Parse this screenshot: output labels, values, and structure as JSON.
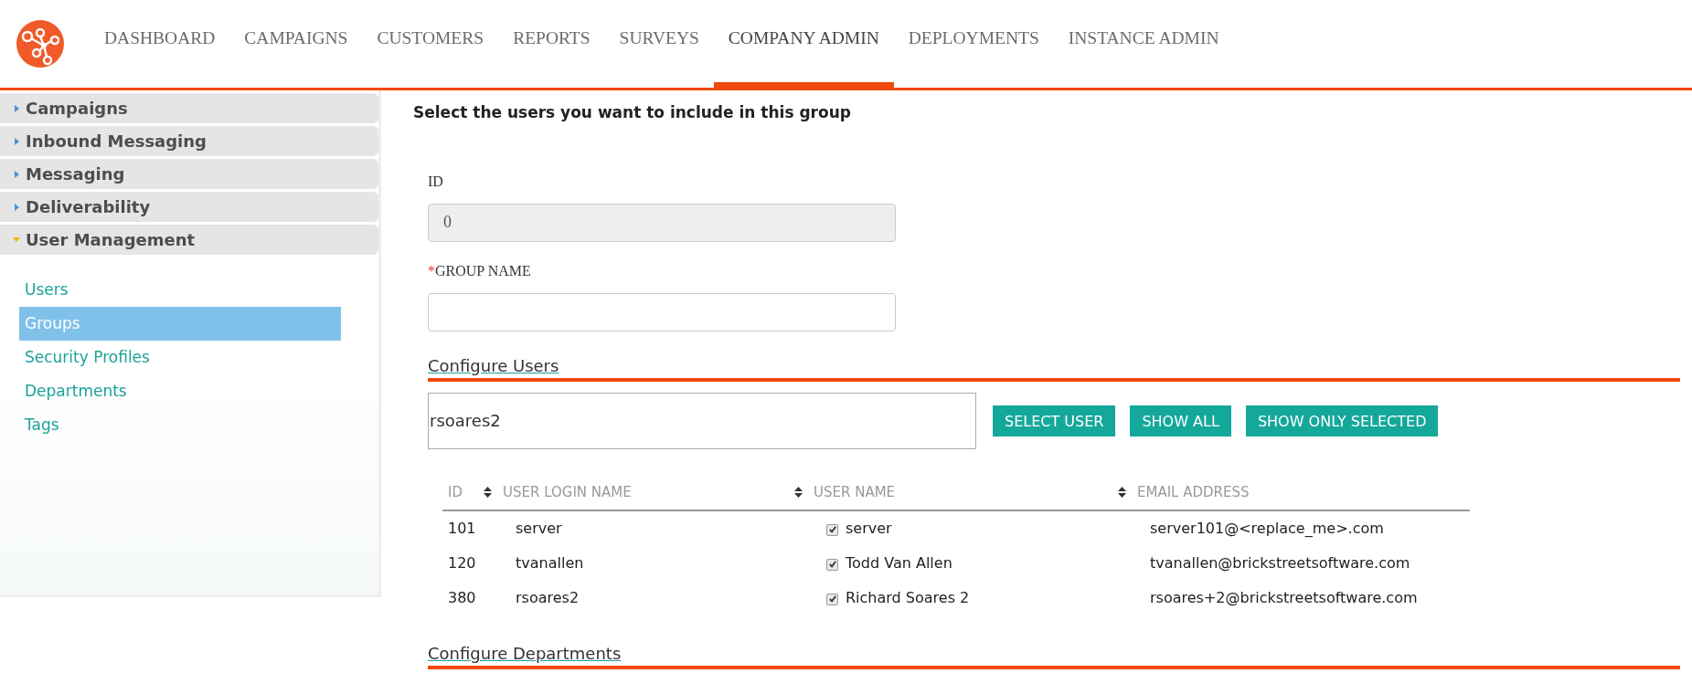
{
  "nav": [
    {
      "label": "DASHBOARD",
      "selected": false
    },
    {
      "label": "CAMPAIGNS",
      "selected": false
    },
    {
      "label": "CUSTOMERS",
      "selected": false
    },
    {
      "label": "REPORTS",
      "selected": false
    },
    {
      "label": "SURVEYS",
      "selected": false
    },
    {
      "label": "COMPANY ADMIN",
      "selected": true
    },
    {
      "label": "DEPLOYMENTS",
      "selected": false
    },
    {
      "label": "INSTANCE ADMIN",
      "selected": false
    }
  ],
  "sidebar": {
    "sections": [
      {
        "label": "Campaigns",
        "expanded": false
      },
      {
        "label": "Inbound Messaging",
        "expanded": false
      },
      {
        "label": "Messaging",
        "expanded": false
      },
      {
        "label": "Deliverability",
        "expanded": false
      },
      {
        "label": "User Management",
        "expanded": true,
        "items": [
          {
            "label": "Users",
            "selected": false
          },
          {
            "label": "Groups",
            "selected": true
          },
          {
            "label": "Security Profiles",
            "selected": false
          },
          {
            "label": "Departments",
            "selected": false
          },
          {
            "label": "Tags",
            "selected": false
          }
        ]
      }
    ]
  },
  "heading": "Select the users you want to include in this group",
  "fields": [
    {
      "label": "ID",
      "required": false,
      "value": "0",
      "disabled": true
    },
    {
      "label": "GROUP NAME",
      "required": true,
      "required_mark": "*",
      "disabled": false
    }
  ],
  "configure_users": {
    "title": "Configure Users",
    "search_value": "rsoares2",
    "buttons": [
      "SELECT USER",
      "SHOW ALL",
      "SHOW ONLY SELECTED"
    ],
    "table": {
      "columns": [
        "ID",
        "USER LOGIN NAME",
        "USER NAME",
        "EMAIL ADDRESS"
      ],
      "rows": [
        {
          "id": "101",
          "login": "server",
          "checked": true,
          "name": "server",
          "email": "server101@<replace_me>.com"
        },
        {
          "id": "120",
          "login": "tvanallen",
          "checked": true,
          "name": "Todd Van Allen",
          "email": "tvanallen@brickstreetsoftware.com"
        },
        {
          "id": "380",
          "login": "rsoares2",
          "checked": true,
          "name": "Richard Soares 2",
          "email": "rsoares+2@brickstreetsoftware.com"
        }
      ]
    }
  },
  "configure_departments": {
    "title": "Configure Departments"
  }
}
